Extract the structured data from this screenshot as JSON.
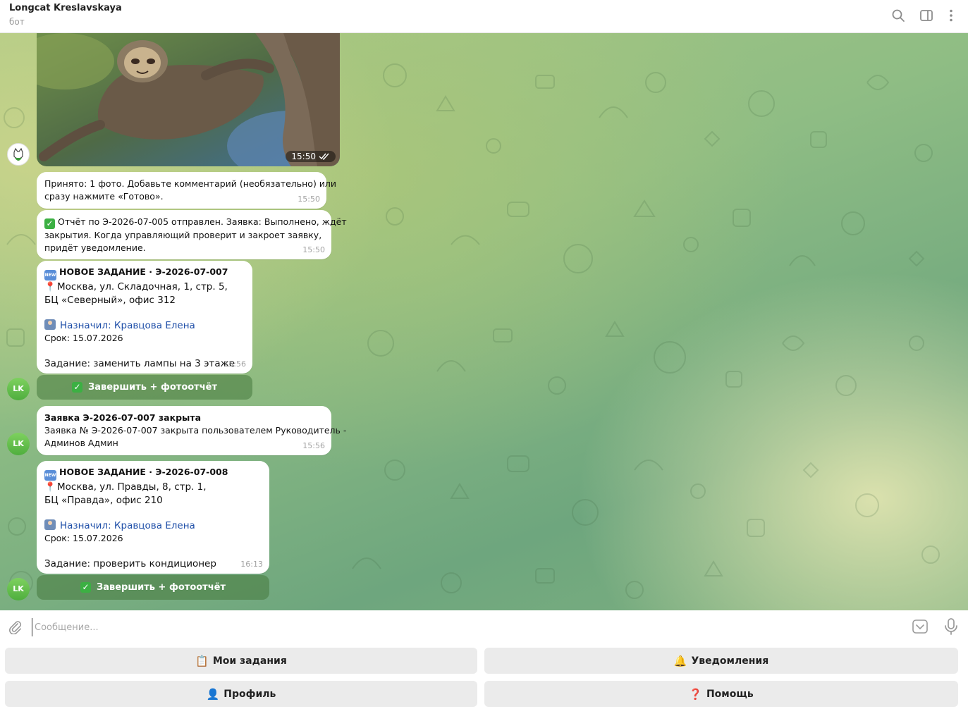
{
  "header": {
    "title": "Longcat Kreslavskaya",
    "subtitle": "бот"
  },
  "photo_message": {
    "time": "15:50"
  },
  "messages": [
    {
      "lines": [
        "Принято: 1 фото. Добавьте комментарий (необязательно) или",
        "сразу нажмите «Готово»."
      ],
      "time": "15:50"
    },
    {
      "lines": [
        "Отчёт по Э-2026-07-005 отправлен. Заявка: Выполнено, ждёт",
        "закрытия. Когда управляющий проверит и закроет заявку,",
        "придёт уведомление."
      ],
      "time": "15:50"
    },
    {
      "title": "НОВОЕ ЗАДАНИЕ · Э-2026-07-007",
      "address_1": "Москва, ул. Складочная, 1, стр. 5,",
      "address_2": "БЦ «Северный», офис 312",
      "assigned": "Назначил: Кравцова Елена",
      "deadline": "Срок: 15.07.2026",
      "task": "Задание: заменить лампы на 3 этаже",
      "time": "15:56",
      "button": "Завершить + фотоотчёт"
    },
    {
      "title": "Заявка Э-2026-07-007 закрыта",
      "lines": [
        "Заявка № Э-2026-07-007 закрыта пользователем Руководитель -",
        "Админов Админ"
      ],
      "time": "15:56"
    },
    {
      "title": "НОВОЕ ЗАДАНИЕ · Э-2026-07-008",
      "address_1": "Москва, ул. Правды, 8, стр. 1,",
      "address_2": "БЦ «Правда», офис 210",
      "assigned": "Назначил: Кравцова Елена",
      "deadline": "Срок: 15.07.2026",
      "task": "Задание: проверить кондиционер",
      "time": "16:13",
      "button": "Завершить + фотоотчёт"
    }
  ],
  "avatar_initials": "LK",
  "input": {
    "placeholder": "Сообщение..."
  },
  "keyboard": [
    {
      "label": "Мои задания",
      "icon": "clipboard-icon",
      "emoji": "📋"
    },
    {
      "label": "Уведомления",
      "icon": "bell-icon",
      "emoji": "🔔"
    },
    {
      "label": "Профиль",
      "icon": "person-icon",
      "emoji": "👤"
    },
    {
      "label": "Помощь",
      "icon": "question-icon",
      "emoji": "❓"
    }
  ],
  "colors": {
    "accent": "#4fae3e",
    "link": "#1f4fa8",
    "bubble": "#ffffff",
    "inline_button": "#5a8a50"
  }
}
